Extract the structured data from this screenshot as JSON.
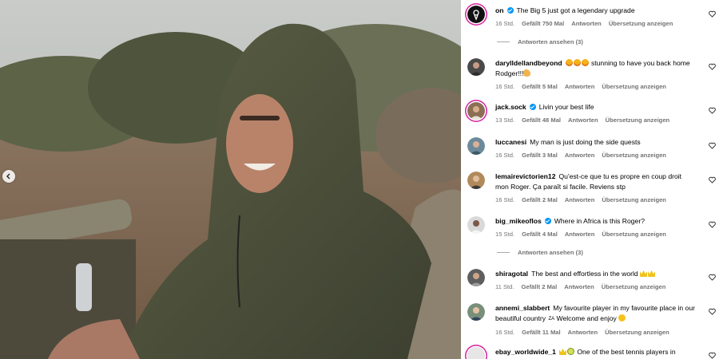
{
  "post": {
    "prev_icon": "chevron-left-icon"
  },
  "comments": [
    {
      "user": "on",
      "verified": true,
      "text": "The Big 5 just got a legendary upgrade",
      "time": "16 Std.",
      "likes": "Gefällt 750 Mal",
      "reply": "Antworten",
      "translate": "Übersetzung anzeigen",
      "replies": "Antworten ansehen (3)"
    },
    {
      "user": "darylldellandbeyond",
      "verified": false,
      "text": "stunning to have you back home Rodger!!!",
      "time": "16 Std.",
      "likes": "Gefällt 5 Mal",
      "reply": "Antworten",
      "translate": "Übersetzung anzeigen"
    },
    {
      "user": "jack.sock",
      "verified": true,
      "text": "Livin your best life",
      "time": "13 Std.",
      "likes": "Gefällt 48 Mal",
      "reply": "Antworten",
      "translate": "Übersetzung anzeigen"
    },
    {
      "user": "luccanesi",
      "verified": false,
      "text": "My man is just doing the side quests",
      "time": "16 Std.",
      "likes": "Gefällt 3 Mal",
      "reply": "Antworten",
      "translate": "Übersetzung anzeigen"
    },
    {
      "user": "lemairevictorien12",
      "verified": false,
      "text": "Qu'est-ce que tu es propre en coup droit mon Roger. Ça paraît si facile. Reviens stp",
      "time": "16 Std.",
      "likes": "Gefällt 2 Mal",
      "reply": "Antworten",
      "translate": "Übersetzung anzeigen"
    },
    {
      "user": "big_mikeoflos",
      "verified": true,
      "text": "Where in Africa is this Roger?",
      "time": "15 Std.",
      "likes": "Gefällt 4 Mal",
      "reply": "Antworten",
      "translate": "Übersetzung anzeigen",
      "replies": "Antworten ansehen (3)"
    },
    {
      "user": "shiragotal",
      "verified": false,
      "text": "The best and effortless in the world",
      "time": "11 Std.",
      "likes": "Gefällt 2 Mal",
      "reply": "Antworten",
      "translate": "Übersetzung anzeigen"
    },
    {
      "user": "annemi_slabbert",
      "verified": false,
      "text": "My favourite player in my favourite place in our beautiful country",
      "flag": "ZA",
      "text2": "Welcome and enjoy",
      "time": "16 Std.",
      "likes": "Gefällt 11 Mal",
      "reply": "Antworten",
      "translate": "Übersetzung anzeigen"
    },
    {
      "user": "ebay_worldwide_1",
      "verified": false,
      "text": "One of the best tennis players in"
    }
  ]
}
